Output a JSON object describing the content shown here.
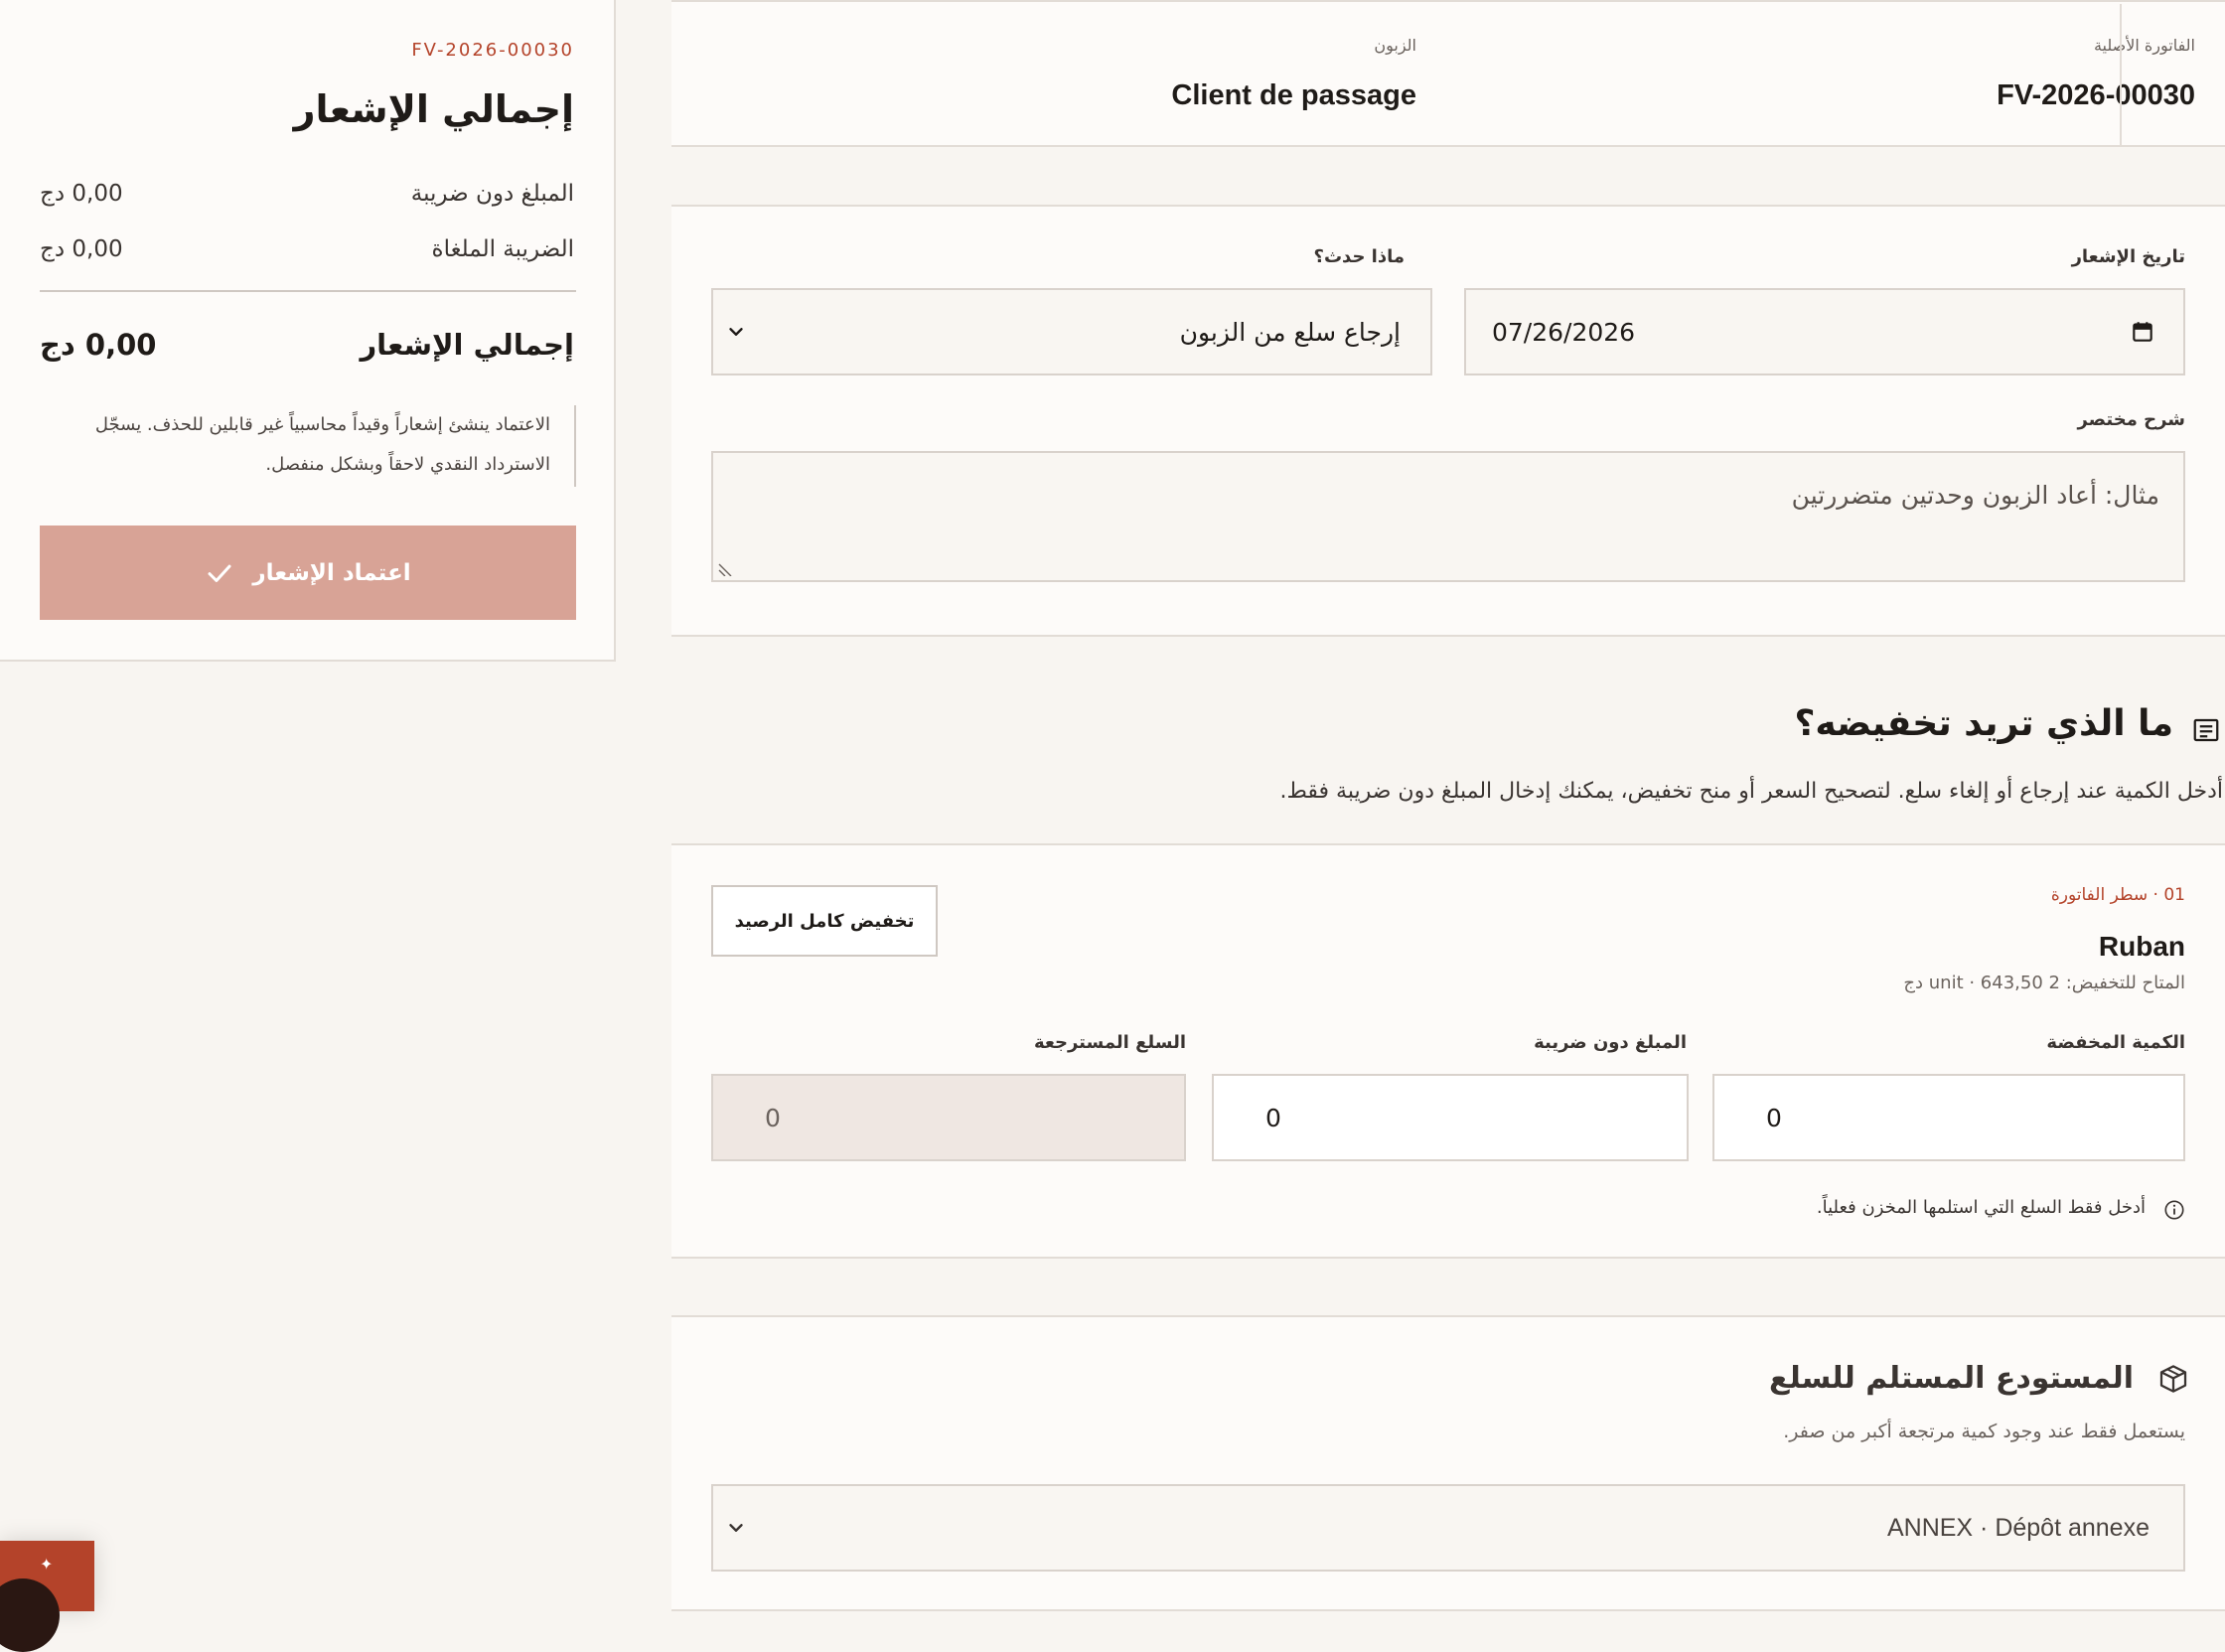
{
  "summary": {
    "invoice_ref": "FV-2026-00030",
    "title": "إجمالي الإشعار",
    "rows": [
      {
        "label": "المبلغ دون ضريبة",
        "value": "0,00 دج"
      },
      {
        "label": "الضريبة الملغاة",
        "value": "0,00 دج"
      }
    ],
    "total_label": "إجمالي الإشعار",
    "total_value": "0,00 دج",
    "note": "الاعتماد ينشئ إشعاراً وقيداً محاسبياً غير قابلين للحذف. يسجّل الاسترداد النقدي لاحقاً وبشكل منفصل.",
    "approve_label": "اعتماد الإشعار"
  },
  "info": {
    "original_invoice_label": "الفاتورة الأصلية",
    "original_invoice_value": "FV-2026-00030",
    "customer_label": "الزبون",
    "customer_value": "Client de passage"
  },
  "form": {
    "date_label": "تاريخ الإشعار",
    "date_value": "07/26/2026",
    "reason_label": "ماذا حدث؟",
    "reason_value": "إرجاع سلع من الزبون",
    "desc_label": "شرح مختصر",
    "desc_placeholder": "مثال: أعاد الزبون وحدتين متضررتين"
  },
  "reduce_section": {
    "title": "ما الذي تريد تخفيضه؟",
    "subtitle": "أدخل الكمية عند إرجاع أو إلغاء سلع. لتصحيح السعر أو منح تخفيض، يمكنك إدخال المبلغ دون ضريبة فقط."
  },
  "line": {
    "ref": "01 · سطر الفاتورة",
    "product": "Ruban",
    "available": "المتاح للتخفيض: 2 unit · 643,50 دج",
    "full_button": "تخفيض كامل الرصيد",
    "qty_label": "الكمية المخفضة",
    "qty_value": "0",
    "amount_label": "المبلغ دون ضريبة",
    "amount_value": "0",
    "returned_label": "السلع المسترجعة",
    "returned_value": "0",
    "hint": "أدخل فقط السلع التي استلمها المخزن فعلياً."
  },
  "warehouse": {
    "title": "المستودع المستلم للسلع",
    "subtitle": "يستعمل فقط عند وجود كمية مرتجعة أكبر من صفر.",
    "value": "ANNEX · Dépôt annexe"
  },
  "colors": {
    "accent": "#b4432a",
    "approve_disabled": "#d8a396",
    "background": "#f8f5f1",
    "panel": "#fdfbf9"
  }
}
